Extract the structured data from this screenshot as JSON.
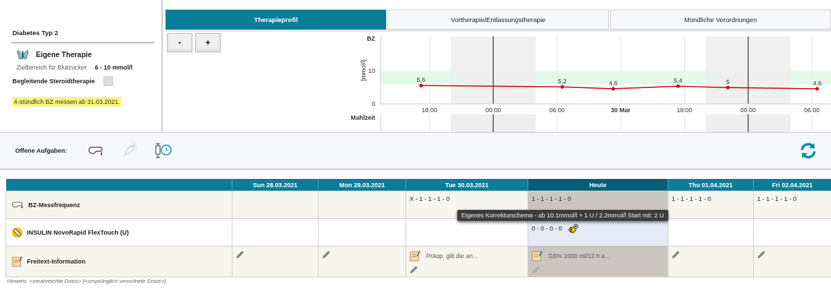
{
  "patient": {
    "diagnosis": "Diabetes Typ 2",
    "therapy": "Eigene Therapie",
    "target_label": "Zielbereich für Blutzucker",
    "target_value": "6 - 10 mmol/l",
    "steroid_label": "Begleitende Steroidtherapie",
    "steroid_checked": false,
    "note": "4-stündlich BZ messen ab 31.03.2021."
  },
  "tabs": [
    {
      "label": "Therapieprofil",
      "selected": true
    },
    {
      "label": "Vortherapie/Entlassungstherapie",
      "selected": false
    },
    {
      "label": "Mündliche Verordnungen",
      "selected": false
    }
  ],
  "zoom_buttons": [
    "-",
    "+"
  ],
  "chart": {
    "meal_label": "Mahlzeit",
    "chart_data": {
      "type": "line",
      "title": "BZ",
      "ylabel": "[mmol/l]",
      "xlim": [
        "2021-03-29T13:24",
        "2021-03-31T07:48"
      ],
      "ylim": [
        0,
        20.6
      ],
      "yticks": [
        0,
        10
      ],
      "xticks": [
        {
          "value": "2021-03-29T18:00",
          "label": "18:00"
        },
        {
          "value": "2021-03-30T00:00",
          "label": "00:00"
        },
        {
          "value": "2021-03-30T06:00",
          "label": "06:00"
        },
        {
          "value": "2021-03-30T12:00",
          "label": "30 Mar"
        },
        {
          "value": "2021-03-30T18:00",
          "label": "18:00"
        },
        {
          "value": "2021-03-31T00:00",
          "label": "00:00"
        },
        {
          "value": "2021-03-31T06:00",
          "label": "06:00"
        }
      ],
      "x": [
        "2021-03-29T17:12",
        "2021-03-30T06:30",
        "2021-03-30T11:18",
        "2021-03-30T17:24",
        "2021-03-30T22:06",
        "2021-03-31T06:30"
      ],
      "series": [
        {
          "color": "#cc0000",
          "values": [
            5.6,
            5.2,
            4.6,
            5.4,
            5,
            4.6
          ]
        }
      ],
      "value_labels": [
        "5,6",
        "5,2",
        "4,6",
        "5,4",
        "5",
        "4,6"
      ],
      "grid": true,
      "bands": [
        {
          "axis": "y",
          "from": 6,
          "to": 10
        },
        {
          "axis": "x",
          "from": "2021-03-29T20:00",
          "to": "2021-03-30T04:00"
        },
        {
          "axis": "x",
          "from": "2021-03-30T20:00",
          "to": "2021-03-31T04:00"
        }
      ]
    }
  },
  "tasks": {
    "label": "Offene Aufgaben:",
    "icons": [
      {
        "kind": "finger",
        "disabled": false
      },
      {
        "kind": "syringe",
        "disabled": true
      },
      {
        "kind": "syringe-clock",
        "disabled": false
      }
    ]
  },
  "table": {
    "columns": [
      {
        "label": "Sun 28.03.2021",
        "today": false
      },
      {
        "label": "Mon 29.03.2021",
        "today": false
      },
      {
        "label": "Tue 30.03.2021",
        "today": false
      },
      {
        "label": "Heute",
        "today": true
      },
      {
        "label": "Thu 01.04.2021",
        "today": false
      },
      {
        "label": "Fri 02.04.2021",
        "today": false
      }
    ],
    "rows": [
      {
        "kind": "measure",
        "label": "BZ-Messfrequenz",
        "cells": [
          {},
          {},
          {
            "text": "X - 1 - 1 - 1 - 0"
          },
          {
            "text": "1 - 1 - 1 - 1 - 0"
          },
          {
            "text": "1 - 1 - 1 - 1 - 0"
          },
          {
            "text": "1 - 1 - 1 - 1 - 0"
          }
        ]
      },
      {
        "kind": "insulin",
        "label": "INSULIN NovoRapid FlexTouch (U)",
        "cells": [
          {},
          {},
          {},
          {
            "text": "0 - 0 - 0 - 0",
            "correction": true
          },
          {},
          {}
        ]
      },
      {
        "kind": "freetext",
        "label": "Freitext-Information",
        "cells": [
          {
            "editable": true
          },
          {
            "editable": true
          },
          {
            "note": "Präop. gilt die an...",
            "editable": true
          },
          {
            "note": "G5% 1000 ml/12 h a...",
            "editable": true
          },
          {
            "editable": true
          },
          {
            "editable": true
          }
        ]
      }
    ],
    "tooltip": "Eigenes Korrekturschema - ab 10.1mmol/l + 1 U / 2.2mmol/l Start mit: 2 U"
  },
  "footnote": "Hinweis: <verabreichte Dosis> [<ursprünglich verordnete Dosis>]"
}
